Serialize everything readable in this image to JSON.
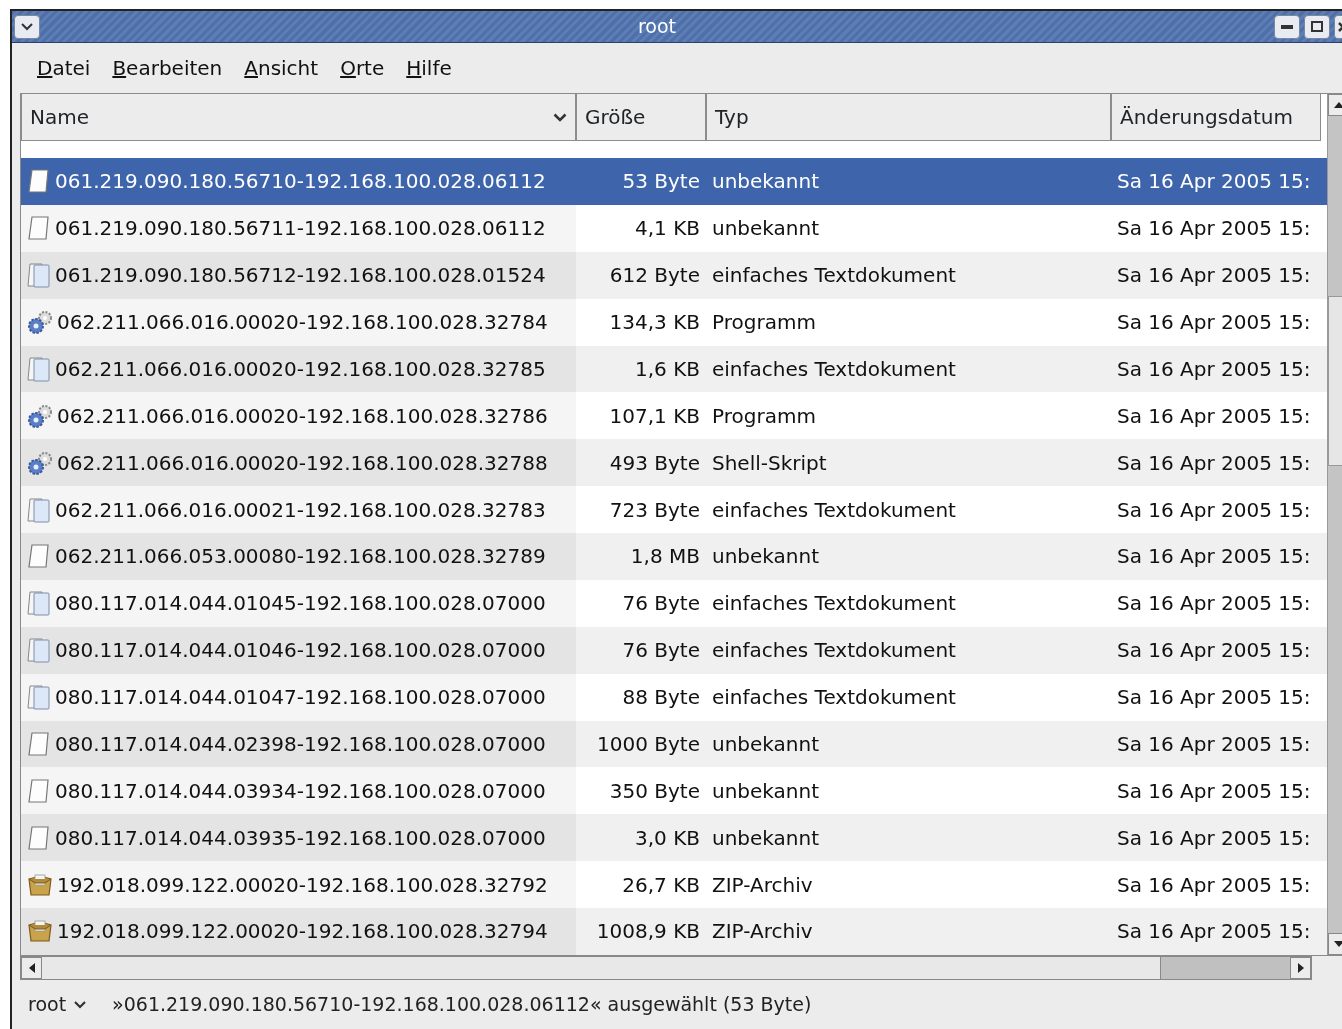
{
  "window": {
    "title": "root"
  },
  "menu": [
    {
      "label": "Datei"
    },
    {
      "label": "Bearbeiten"
    },
    {
      "label": "Ansicht"
    },
    {
      "label": "Orte"
    },
    {
      "label": "Hilfe"
    }
  ],
  "table": {
    "columns": [
      {
        "label": "Name",
        "sorted": true
      },
      {
        "label": "Größe",
        "sorted": false
      },
      {
        "label": "Typ",
        "sorted": false
      },
      {
        "label": "Änderungsdatum",
        "sorted": false
      }
    ],
    "rows": [
      {
        "kind": "unknown",
        "name": "061.219.090.180.56710-192.168.100.028.06112",
        "size": "53 Byte",
        "type": "unbekannt",
        "date": "Sa 16 Apr 2005 15:",
        "selected": true
      },
      {
        "kind": "unknown",
        "name": "061.219.090.180.56711-192.168.100.028.06112",
        "size": "4,1 KB",
        "type": "unbekannt",
        "date": "Sa 16 Apr 2005 15:",
        "selected": false
      },
      {
        "kind": "text",
        "name": "061.219.090.180.56712-192.168.100.028.01524",
        "size": "612 Byte",
        "type": "einfaches Textdokument",
        "date": "Sa 16 Apr 2005 15:",
        "selected": false
      },
      {
        "kind": "program",
        "name": "062.211.066.016.00020-192.168.100.028.32784",
        "size": "134,3 KB",
        "type": "Programm",
        "date": "Sa 16 Apr 2005 15:",
        "selected": false
      },
      {
        "kind": "text",
        "name": "062.211.066.016.00020-192.168.100.028.32785",
        "size": "1,6 KB",
        "type": "einfaches Textdokument",
        "date": "Sa 16 Apr 2005 15:",
        "selected": false
      },
      {
        "kind": "program",
        "name": "062.211.066.016.00020-192.168.100.028.32786",
        "size": "107,1 KB",
        "type": "Programm",
        "date": "Sa 16 Apr 2005 15:",
        "selected": false
      },
      {
        "kind": "program",
        "name": "062.211.066.016.00020-192.168.100.028.32788",
        "size": "493 Byte",
        "type": "Shell-Skript",
        "date": "Sa 16 Apr 2005 15:",
        "selected": false
      },
      {
        "kind": "text",
        "name": "062.211.066.016.00021-192.168.100.028.32783",
        "size": "723 Byte",
        "type": "einfaches Textdokument",
        "date": "Sa 16 Apr 2005 15:",
        "selected": false
      },
      {
        "kind": "unknown",
        "name": "062.211.066.053.00080-192.168.100.028.32789",
        "size": "1,8 MB",
        "type": "unbekannt",
        "date": "Sa 16 Apr 2005 15:",
        "selected": false
      },
      {
        "kind": "text",
        "name": "080.117.014.044.01045-192.168.100.028.07000",
        "size": "76 Byte",
        "type": "einfaches Textdokument",
        "date": "Sa 16 Apr 2005 15:",
        "selected": false
      },
      {
        "kind": "text",
        "name": "080.117.014.044.01046-192.168.100.028.07000",
        "size": "76 Byte",
        "type": "einfaches Textdokument",
        "date": "Sa 16 Apr 2005 15:",
        "selected": false
      },
      {
        "kind": "text",
        "name": "080.117.014.044.01047-192.168.100.028.07000",
        "size": "88 Byte",
        "type": "einfaches Textdokument",
        "date": "Sa 16 Apr 2005 15:",
        "selected": false
      },
      {
        "kind": "unknown",
        "name": "080.117.014.044.02398-192.168.100.028.07000",
        "size": "1000 Byte",
        "type": "unbekannt",
        "date": "Sa 16 Apr 2005 15:",
        "selected": false
      },
      {
        "kind": "unknown",
        "name": "080.117.014.044.03934-192.168.100.028.07000",
        "size": "350 Byte",
        "type": "unbekannt",
        "date": "Sa 16 Apr 2005 15:",
        "selected": false
      },
      {
        "kind": "unknown",
        "name": "080.117.014.044.03935-192.168.100.028.07000",
        "size": "3,0 KB",
        "type": "unbekannt",
        "date": "Sa 16 Apr 2005 15:",
        "selected": false
      },
      {
        "kind": "archive",
        "name": "192.018.099.122.00020-192.168.100.028.32792",
        "size": "26,7 KB",
        "type": "ZIP-Archiv",
        "date": "Sa 16 Apr 2005 15:",
        "selected": false
      },
      {
        "kind": "archive",
        "name": "192.018.099.122.00020-192.168.100.028.32794",
        "size": "1008,9 KB",
        "type": "ZIP-Archiv",
        "date": "Sa 16 Apr 2005 15:",
        "selected": false
      }
    ]
  },
  "status_bar": {
    "location": "root",
    "message": "»061.219.090.180.56710-192.168.100.028.06112« ausgewählt (53 Byte)"
  }
}
